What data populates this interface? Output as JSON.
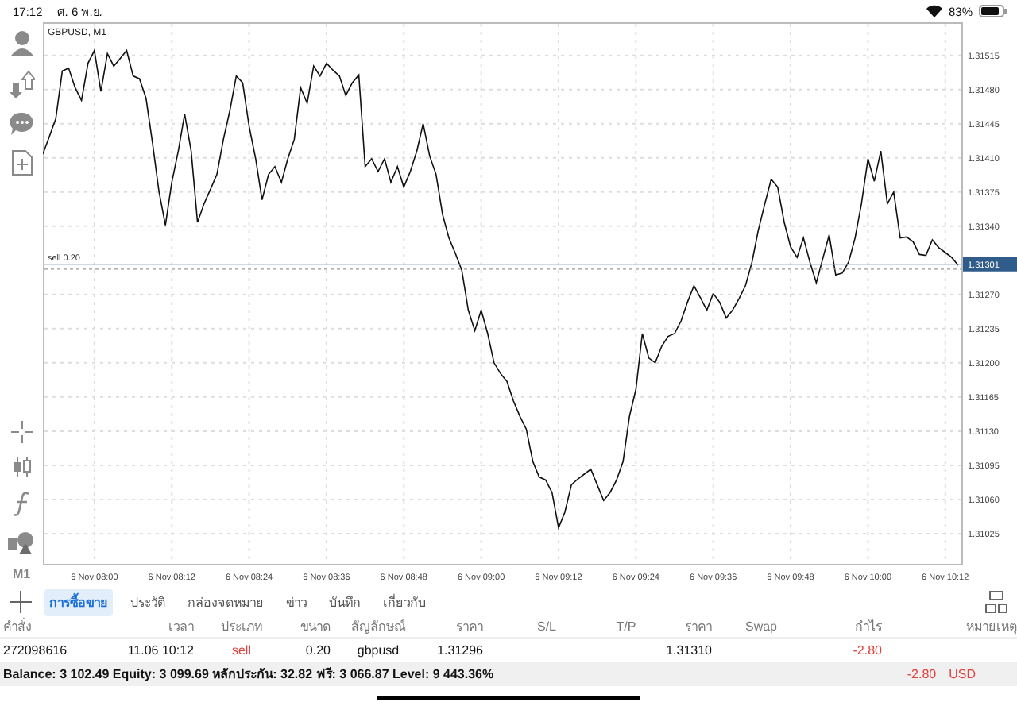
{
  "status_bar": {
    "time": "17:12",
    "date": "ศ. 6 พ.ย.",
    "battery_text": "83%"
  },
  "toolbar": {
    "timeframe": "M1"
  },
  "chart": {
    "title": "GBPUSD, M1",
    "chart_data": {
      "type": "line",
      "grid": true,
      "ref_lines": [
        {
          "axis": "y",
          "value": 1.31296,
          "label": "sell 0.20",
          "color": "#999999"
        },
        {
          "axis": "y",
          "value": 1.31301,
          "label": "1.31301",
          "color": "#9fb4cc"
        }
      ],
      "categories": [
        null,
        null,
        null,
        null,
        null,
        null,
        null,
        null,
        "6 Nov 08:00",
        null,
        null,
        null,
        null,
        null,
        null,
        null,
        null,
        null,
        null,
        null,
        "6 Nov 08:12",
        null,
        null,
        null,
        null,
        null,
        null,
        null,
        null,
        null,
        null,
        null,
        "6 Nov 08:24",
        null,
        null,
        null,
        null,
        null,
        null,
        null,
        null,
        null,
        null,
        null,
        "6 Nov 08:36",
        null,
        null,
        null,
        null,
        null,
        null,
        null,
        null,
        null,
        null,
        null,
        "6 Nov 08:48",
        null,
        null,
        null,
        null,
        null,
        null,
        null,
        null,
        null,
        null,
        null,
        "6 Nov 09:00",
        null,
        null,
        null,
        null,
        null,
        null,
        null,
        null,
        null,
        null,
        null,
        "6 Nov 09:12",
        null,
        null,
        null,
        null,
        null,
        null,
        null,
        null,
        null,
        null,
        null,
        "6 Nov 09:24",
        null,
        null,
        null,
        null,
        null,
        null,
        null,
        null,
        null,
        null,
        null,
        "6 Nov 09:36",
        null,
        null,
        null,
        null,
        null,
        null,
        null,
        null,
        null,
        null,
        null,
        "6 Nov 09:48",
        null,
        null,
        null,
        null,
        null,
        null,
        null,
        null,
        null,
        null,
        null,
        "6 Nov 10:00",
        null,
        null,
        null,
        null,
        null,
        null,
        null,
        null,
        null,
        null,
        null,
        "6 Nov 10:12",
        null,
        null
      ],
      "series": [
        {
          "color": "#111111",
          "values": [
            1.31414,
            1.31432,
            1.3145,
            1.31499,
            1.31502,
            1.31482,
            1.31469,
            1.31507,
            1.3152,
            1.31478,
            1.31517,
            1.31504,
            1.31512,
            1.3152,
            1.31494,
            1.31491,
            1.31471,
            1.31425,
            1.31376,
            1.31341,
            1.31385,
            1.31417,
            1.31455,
            1.31417,
            1.31344,
            1.31363,
            1.31378,
            1.31393,
            1.31429,
            1.31458,
            1.31494,
            1.31487,
            1.31442,
            1.31409,
            1.31367,
            1.31393,
            1.31401,
            1.31385,
            1.31409,
            1.31429,
            1.31482,
            1.31466,
            1.31504,
            1.31494,
            1.31507,
            1.315,
            1.31494,
            1.31474,
            1.31487,
            1.31495,
            1.31401,
            1.31409,
            1.31396,
            1.31409,
            1.31385,
            1.31401,
            1.3138,
            1.31396,
            1.31417,
            1.31445,
            1.31412,
            1.31393,
            1.31352,
            1.31328,
            1.31312,
            1.31295,
            1.31254,
            1.31233,
            1.31254,
            1.3123,
            1.312,
            1.31189,
            1.31181,
            1.31161,
            1.31145,
            1.31132,
            1.31099,
            1.31083,
            1.3108,
            1.31067,
            1.31031,
            1.31047,
            1.31075,
            1.31081,
            1.31086,
            1.31091,
            1.31075,
            1.31059,
            1.31067,
            1.3108,
            1.31099,
            1.31145,
            1.31173,
            1.3123,
            1.31205,
            1.312,
            1.31217,
            1.31227,
            1.3123,
            1.31243,
            1.31262,
            1.31279,
            1.31267,
            1.31254,
            1.31271,
            1.31262,
            1.31246,
            1.31254,
            1.31266,
            1.31279,
            1.31303,
            1.31336,
            1.31363,
            1.31388,
            1.3138,
            1.31344,
            1.31319,
            1.31308,
            1.31328,
            1.31303,
            1.31282,
            1.31307,
            1.31331,
            1.3129,
            1.31292,
            1.31303,
            1.31328,
            1.31363,
            1.31409,
            1.31386,
            1.31417,
            1.31363,
            1.31375,
            1.31328,
            1.31329,
            1.31324,
            1.31311,
            1.3131,
            1.31326,
            1.31318,
            1.31313,
            1.31308,
            1.313
          ]
        }
      ],
      "ylim": [
        1.30994,
        1.31549
      ],
      "yticks": [
        {
          "value": 1.31515,
          "label": "1.31515"
        },
        {
          "value": 1.3148,
          "label": "1.31480"
        },
        {
          "value": 1.31445,
          "label": "1.31445"
        },
        {
          "value": 1.3141,
          "label": "1.31410"
        },
        {
          "value": 1.31375,
          "label": "1.31375"
        },
        {
          "value": 1.3134,
          "label": "1.31340"
        },
        {
          "value": 1.3127,
          "label": "1.31270"
        },
        {
          "value": 1.31235,
          "label": "1.31235"
        },
        {
          "value": 1.312,
          "label": "1.31200"
        },
        {
          "value": 1.31165,
          "label": "1.31165"
        },
        {
          "value": 1.3113,
          "label": "1.31130"
        },
        {
          "value": 1.31095,
          "label": "1.31095"
        },
        {
          "value": 1.3106,
          "label": "1.31060"
        },
        {
          "value": 1.31025,
          "label": "1.31025"
        }
      ]
    }
  },
  "tabs": [
    {
      "label": "การซื้อขาย",
      "selected": true
    },
    {
      "label": "ประวัติ",
      "selected": false
    },
    {
      "label": "กล่องจดหมาย",
      "selected": false
    },
    {
      "label": "ข่าว",
      "selected": false
    },
    {
      "label": "บันทึก",
      "selected": false
    },
    {
      "label": "เกี่ยวกับ",
      "selected": false
    }
  ],
  "table": {
    "columns": [
      "คำสั่ง",
      "เวลา",
      "ประเภท",
      "ขนาด",
      "สัญลักษณ์",
      "ราคา",
      "S/L",
      "T/P",
      "ราคา",
      "Swap",
      "กำไร",
      "หมายเหตุ"
    ],
    "rows": [
      {
        "cells": [
          {
            "text": "272098616",
            "alert": false
          },
          {
            "text": "11.06 10:12",
            "alert": false
          },
          {
            "text": "sell",
            "alert": true
          },
          {
            "text": "0.20",
            "alert": false
          },
          {
            "text": "gbpusd",
            "alert": false
          },
          {
            "text": "1.31296",
            "alert": false
          },
          null,
          null,
          {
            "text": "1.31310",
            "alert": false
          },
          null,
          {
            "text": "-2.80",
            "alert": true
          },
          null
        ]
      }
    ]
  },
  "summary": {
    "text": "Balance: 3 102.49 Equity: 3 099.69 หลักประกัน: 32.82 ฟรี: 3 066.87 Level: 9 443.36%",
    "profit": "-2.80",
    "currency": "USD"
  }
}
